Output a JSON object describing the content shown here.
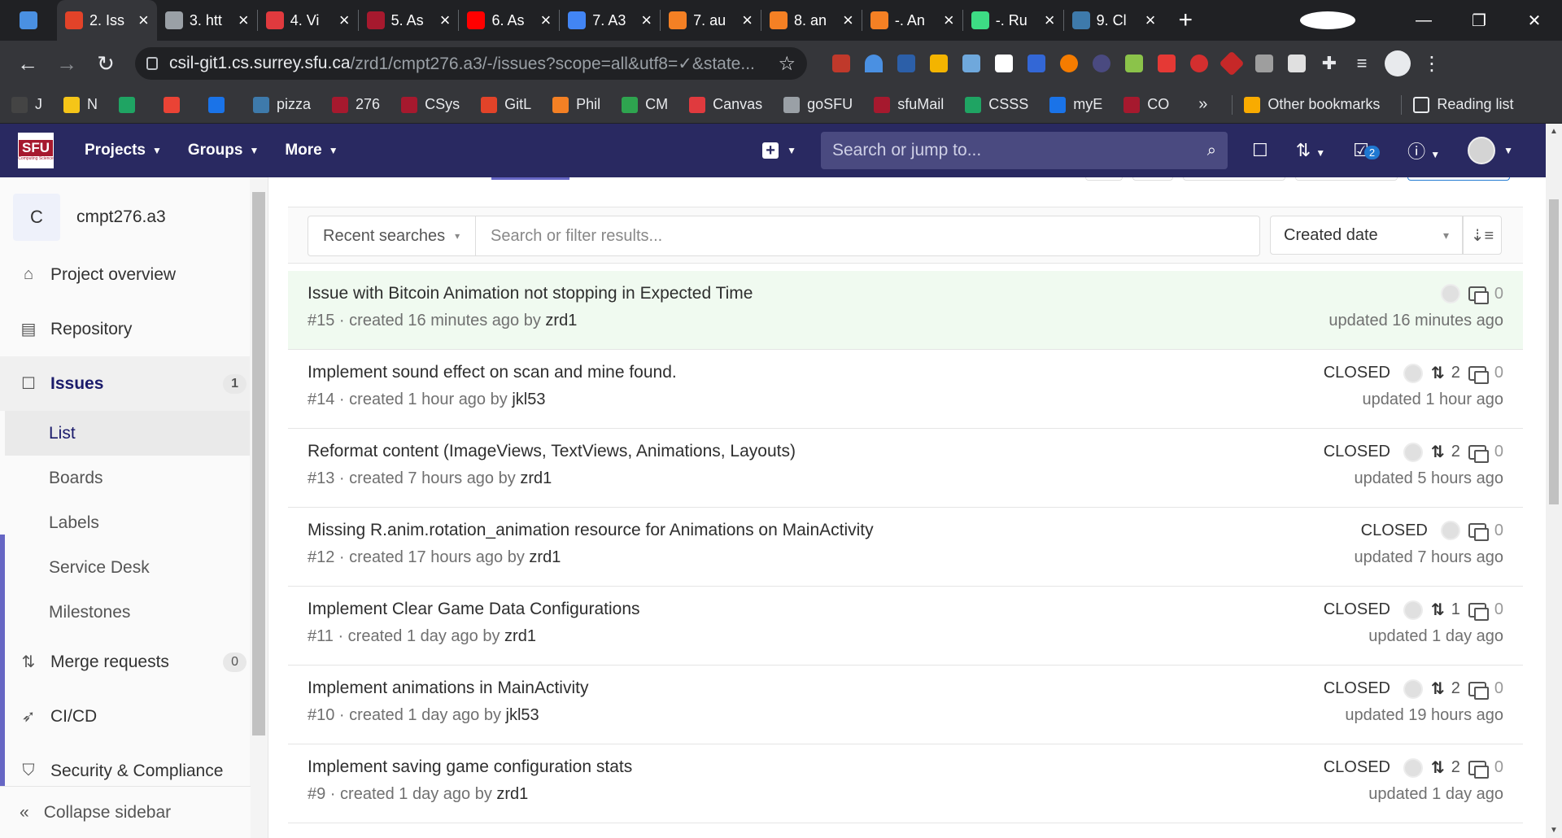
{
  "browser": {
    "tabs": [
      {
        "title": "",
        "icon": "gem-icon",
        "color": "#4a90e2",
        "pinned": true
      },
      {
        "title": "2. Iss",
        "icon": "gitlab-icon",
        "color": "#e24329",
        "active": true
      },
      {
        "title": "3. htt",
        "icon": "globe-icon",
        "color": "#9aa0a6"
      },
      {
        "title": "4. Vi",
        "icon": "canvas-icon",
        "color": "#e03a3e"
      },
      {
        "title": "5. As",
        "icon": "course-icon",
        "color": "#a6192e"
      },
      {
        "title": "6. As",
        "icon": "youtube-icon",
        "color": "#ff0000"
      },
      {
        "title": "7. A3",
        "icon": "docs-icon",
        "color": "#4285f4"
      },
      {
        "title": "7. au",
        "icon": "stackoverflow-icon",
        "color": "#f48024"
      },
      {
        "title": "8. an",
        "icon": "stackoverflow-icon",
        "color": "#f48024"
      },
      {
        "title": "-. An",
        "icon": "stackoverflow-icon",
        "color": "#f48024"
      },
      {
        "title": "-. Ru",
        "icon": "android-icon",
        "color": "#3ddc84"
      },
      {
        "title": "9. Cl",
        "icon": "piazza-icon",
        "color": "#3e7aab"
      }
    ],
    "url_host": "csil-git1.cs.surrey.sfu.ca",
    "url_path": "/zrd1/cmpt276.a3/-/issues?scope=all&utf8=✓&state...",
    "bookmarks": [
      {
        "label": "J",
        "color": "#444"
      },
      {
        "label": "N",
        "color": "#f5c518"
      },
      {
        "label": "",
        "color": "#1fa463"
      },
      {
        "label": "",
        "color": "#ea4335"
      },
      {
        "label": "",
        "color": "#1a73e8"
      },
      {
        "label": "pizza",
        "color": "#3e7aab"
      },
      {
        "label": "276",
        "color": "#a6192e"
      },
      {
        "label": "CSys",
        "color": "#a6192e"
      },
      {
        "label": "GitL",
        "color": "#e24329"
      },
      {
        "label": "Phil",
        "color": "#f48024"
      },
      {
        "label": "CM",
        "color": "#2ea44f"
      },
      {
        "label": "Canvas",
        "color": "#e03a3e"
      },
      {
        "label": "goSFU",
        "color": "#9aa0a6"
      },
      {
        "label": "sfuMail",
        "color": "#a6192e"
      },
      {
        "label": "CSSS",
        "color": "#1fa463"
      },
      {
        "label": "myE",
        "color": "#1a73e8"
      },
      {
        "label": "CO",
        "color": "#a6192e"
      }
    ],
    "bookmarks_more": "»",
    "other_bookmarks": "Other bookmarks",
    "reading_list": "Reading list"
  },
  "gitlab": {
    "logo_text": "SFU",
    "logo_sub": "Computing Science",
    "nav": [
      "Projects",
      "Groups",
      "More"
    ],
    "search_placeholder": "Search or jump to...",
    "todo_count": "2"
  },
  "sidebar": {
    "project_initial": "C",
    "project_name": "cmpt276.a3",
    "items": [
      {
        "label": "Project overview",
        "icon": "home-icon"
      },
      {
        "label": "Repository",
        "icon": "doc-icon"
      },
      {
        "label": "Issues",
        "icon": "issues-icon",
        "count": "1",
        "active": true
      }
    ],
    "issues_sub": [
      "List",
      "Boards",
      "Labels",
      "Service Desk",
      "Milestones"
    ],
    "items_after": [
      {
        "label": "Merge requests",
        "icon": "merge-request-icon",
        "count": "0"
      },
      {
        "label": "CI/CD",
        "icon": "rocket-icon"
      },
      {
        "label": "Security & Compliance",
        "icon": "shield-icon"
      }
    ],
    "collapse_label": "Collapse sidebar"
  },
  "filters": {
    "recent_searches": "Recent searches",
    "search_placeholder": "Search or filter results...",
    "sort_label": "Created date"
  },
  "issues": [
    {
      "title": "Issue with Bitcoin Animation not stopping in Expected Time",
      "id": "#15",
      "created": "created 16 minutes ago by",
      "author": "zrd1",
      "status": "",
      "mrs": "",
      "comments": "0",
      "updated": "updated 16 minutes ago",
      "highlight": true
    },
    {
      "title": "Implement sound effect on scan and mine found.",
      "id": "#14",
      "created": "created 1 hour ago by",
      "author": "jkl53",
      "status": "CLOSED",
      "mrs": "2",
      "comments": "0",
      "updated": "updated 1 hour ago"
    },
    {
      "title": "Reformat content (ImageViews, TextViews, Animations, Layouts)",
      "id": "#13",
      "created": "created 7 hours ago by",
      "author": "zrd1",
      "status": "CLOSED",
      "mrs": "2",
      "comments": "0",
      "updated": "updated 5 hours ago"
    },
    {
      "title": "Missing R.anim.rotation_animation resource for Animations on MainActivity",
      "id": "#12",
      "created": "created 17 hours ago by",
      "author": "zrd1",
      "status": "CLOSED",
      "mrs": "",
      "comments": "0",
      "updated": "updated 7 hours ago"
    },
    {
      "title": "Implement Clear Game Data Configurations",
      "id": "#11",
      "created": "created 1 day ago by",
      "author": "zrd1",
      "status": "CLOSED",
      "mrs": "1",
      "comments": "0",
      "updated": "updated 1 day ago"
    },
    {
      "title": "Implement animations in MainActivity",
      "id": "#10",
      "created": "created 1 day ago by",
      "author": "jkl53",
      "status": "CLOSED",
      "mrs": "2",
      "comments": "0",
      "updated": "updated 19 hours ago"
    },
    {
      "title": "Implement saving game configuration stats",
      "id": "#9",
      "created": "created 1 day ago by",
      "author": "zrd1",
      "status": "CLOSED",
      "mrs": "2",
      "comments": "0",
      "updated": "updated 1 day ago"
    }
  ]
}
